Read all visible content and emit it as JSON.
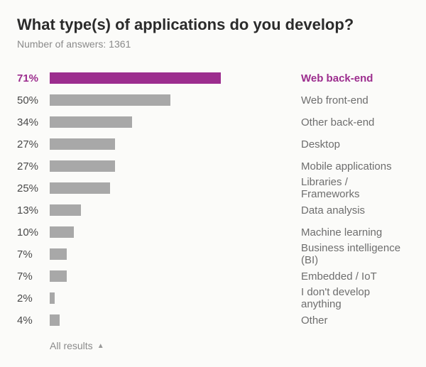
{
  "title": "What type(s) of applications do you develop?",
  "subtitle": "Number of answers: 1361",
  "footer_label": "All results",
  "colors": {
    "highlight": "#9c2d8e",
    "bar": "#a8a8a8"
  },
  "chart_data": {
    "type": "bar",
    "title": "What type(s) of applications do you develop?",
    "xlabel": "",
    "ylabel": "",
    "xlim": [
      0,
      100
    ],
    "categories": [
      "Web back-end",
      "Web front-end",
      "Other back-end",
      "Desktop",
      "Mobile applications",
      "Libraries / Frameworks",
      "Data analysis",
      "Machine learning",
      "Business intelligence (BI)",
      "Embedded / IoT",
      "I don't develop anything",
      "Other"
    ],
    "values": [
      71,
      50,
      34,
      27,
      27,
      25,
      13,
      10,
      7,
      7,
      2,
      4
    ],
    "highlight_index": 0
  },
  "rows": [
    {
      "pct": "71%",
      "label": "Web back-end",
      "value": 71,
      "hl": true
    },
    {
      "pct": "50%",
      "label": "Web front-end",
      "value": 50,
      "hl": false
    },
    {
      "pct": "34%",
      "label": "Other back-end",
      "value": 34,
      "hl": false
    },
    {
      "pct": "27%",
      "label": "Desktop",
      "value": 27,
      "hl": false
    },
    {
      "pct": "27%",
      "label": "Mobile applications",
      "value": 27,
      "hl": false
    },
    {
      "pct": "25%",
      "label": "Libraries / Frameworks",
      "value": 25,
      "hl": false
    },
    {
      "pct": "13%",
      "label": "Data analysis",
      "value": 13,
      "hl": false
    },
    {
      "pct": "10%",
      "label": "Machine learning",
      "value": 10,
      "hl": false
    },
    {
      "pct": "7%",
      "label": "Business intelligence (BI)",
      "value": 7,
      "hl": false
    },
    {
      "pct": "7%",
      "label": "Embedded / IoT",
      "value": 7,
      "hl": false
    },
    {
      "pct": "2%",
      "label": "I don't develop anything",
      "value": 2,
      "hl": false
    },
    {
      "pct": "4%",
      "label": "Other",
      "value": 4,
      "hl": false
    }
  ]
}
